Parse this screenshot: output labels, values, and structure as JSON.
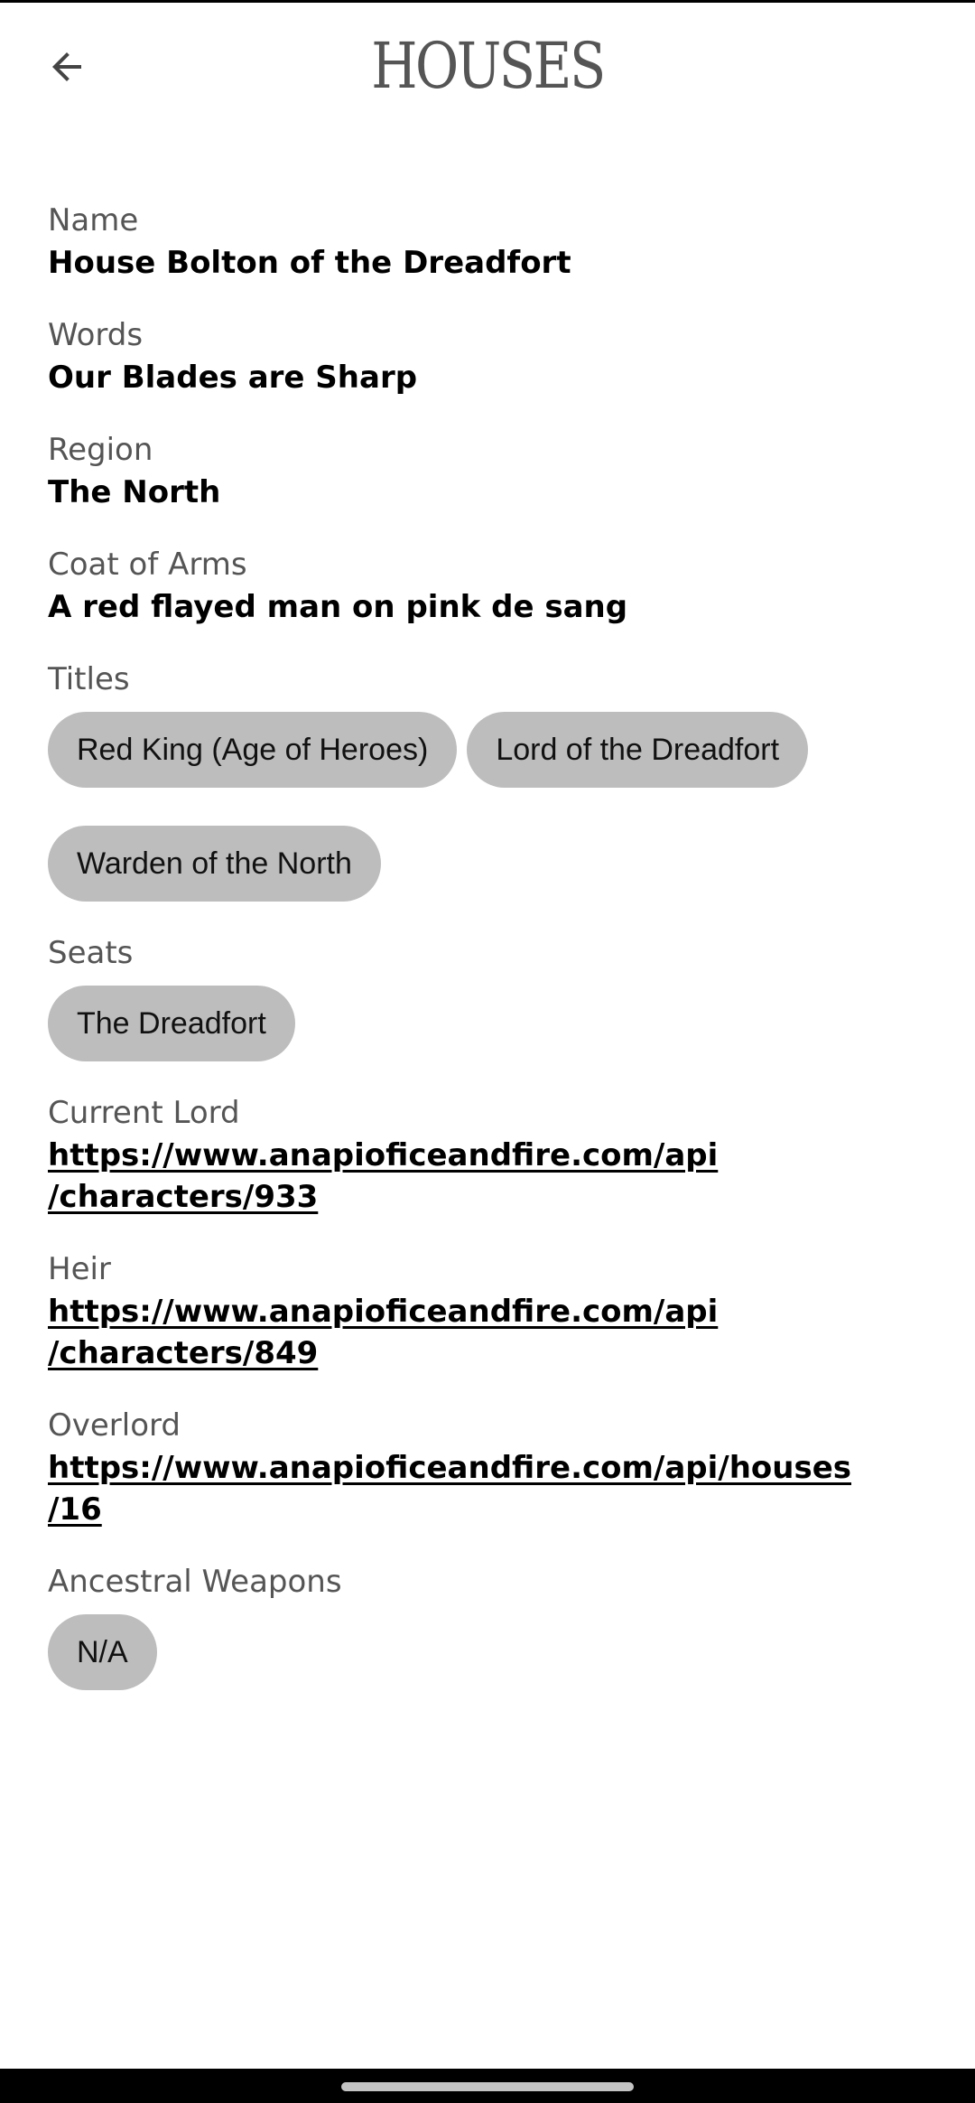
{
  "app_bar": {
    "back_icon": "arrow-back-icon",
    "logo_text": "HOUSES"
  },
  "fields": {
    "name": {
      "label": "Name",
      "value": "House Bolton of the Dreadfort"
    },
    "words": {
      "label": "Words",
      "value": "Our Blades are Sharp"
    },
    "region": {
      "label": "Region",
      "value": "The North"
    },
    "coat_of_arms": {
      "label": "Coat of Arms",
      "value": "A red flayed man on pink de sang"
    },
    "titles": {
      "label": "Titles",
      "items": [
        "Red King (Age of Heroes)",
        "Lord of the Dreadfort",
        "Warden of the North"
      ]
    },
    "seats": {
      "label": "Seats",
      "items": [
        "The Dreadfort"
      ]
    },
    "current_lord": {
      "label": "Current Lord",
      "line1": "https://www.anapioficeandfire.com/api",
      "line2": "/characters/933"
    },
    "heir": {
      "label": "Heir",
      "line1": "https://www.anapioficeandfire.com/api",
      "line2": "/characters/849"
    },
    "overlord": {
      "label": "Overlord",
      "line1": "https://www.anapioficeandfire.com/api/houses",
      "line2": "/16"
    },
    "ancestral_weapons": {
      "label": "Ancestral Weapons",
      "items": [
        "N/A"
      ]
    }
  },
  "colors": {
    "chip_background": "#bdbdbd",
    "label_text": "#555555",
    "value_text": "#000000",
    "background": "#ffffff"
  }
}
